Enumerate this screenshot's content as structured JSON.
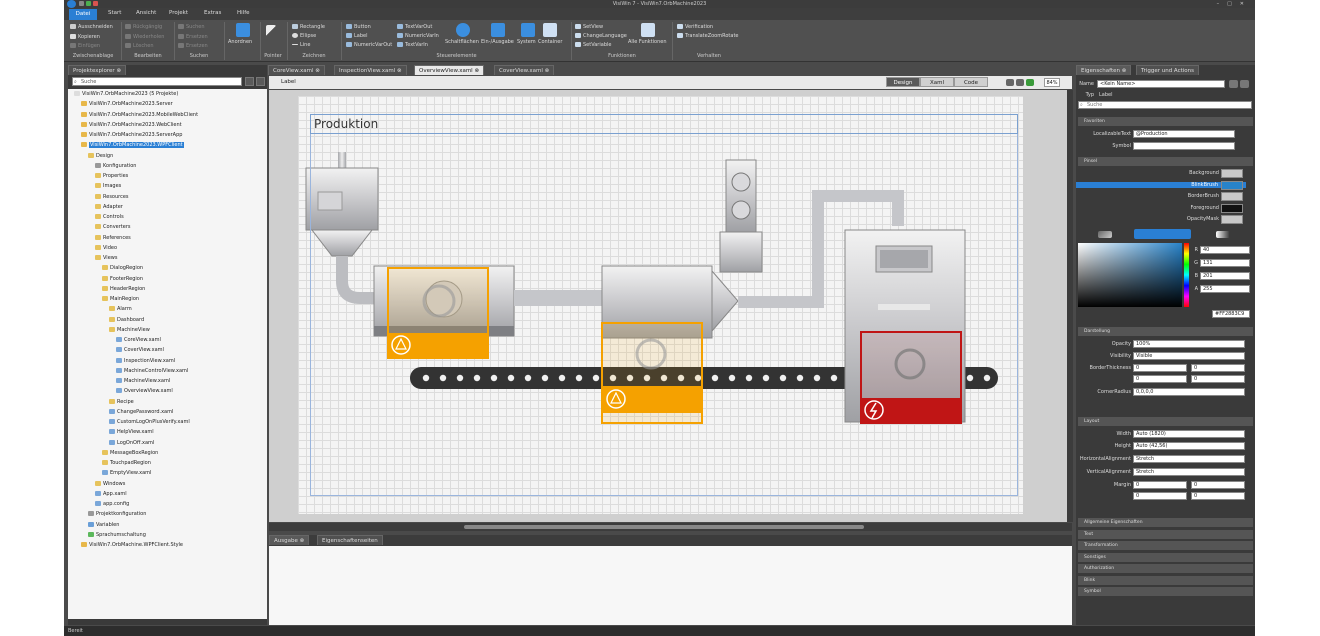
{
  "titlebar": {
    "title": "VisiWin 7 - VisiWin7.OrbMachine2023"
  },
  "menu": {
    "file": "Datei",
    "start": "Start",
    "view": "Ansicht",
    "project": "Projekt",
    "extras": "Extras",
    "help": "Hilfe"
  },
  "ribbon": {
    "clipboard": {
      "cut": "Ausschneiden",
      "copy": "Kopieren",
      "paste": "Einfügen",
      "label": "Zwischenablage"
    },
    "edit": {
      "undo": "Rückgängig",
      "redo": "Wiederholen",
      "delete": "Löschen",
      "label": "Bearbeiten"
    },
    "search": {
      "find": "Suchen",
      "replace": "Ersetzen",
      "replace_all": "Ersetzen",
      "label": "Suchen"
    },
    "arrange": {
      "label": "Anordnen"
    },
    "pointer": {
      "label": "Pointer"
    },
    "draw": {
      "rectangle": "Rectangle",
      "ellipse": "Ellipse",
      "line": "Line",
      "label": "Zeichnen"
    },
    "controls": {
      "button": "Button",
      "label_ctrl": "Label",
      "numericvarout": "NumericVarOut",
      "textvarout": "TextVarOut",
      "numericvarin": "NumericVarIn",
      "textvarin": "TextVarIn",
      "switches": "Schaltflächen",
      "io": "Ein-/Ausgabe",
      "system": "System",
      "container": "Container",
      "label": "Steuerelemente"
    },
    "functions": {
      "setview": "SetView",
      "changelanguage": "ChangeLanguage",
      "setvariable": "SetVariable",
      "all": "Alle Funktionen",
      "label": "Funktionen"
    },
    "behaviors": {
      "verification": "Verification",
      "translatezoomrotate": "TranslateZoomRotate",
      "label": "Verhalten"
    }
  },
  "left": {
    "tab": "Projektexplorer",
    "search_placeholder": "Suche",
    "tree": [
      {
        "label": "VisiWin7.OrbMachine2023 (5 Projekte)",
        "level": 0,
        "icon": "solution",
        "selected": false
      },
      {
        "label": "VisiWin7.OrbMachine2023.Server",
        "level": 1,
        "icon": "project",
        "selected": false
      },
      {
        "label": "VisiWin7.OrbMachine2023.MobileWebClient",
        "level": 1,
        "icon": "project",
        "selected": false
      },
      {
        "label": "VisiWin7.OrbMachine2023.WebClient",
        "level": 1,
        "icon": "project",
        "selected": false
      },
      {
        "label": "VisiWin7.OrbMachine2023.ServerApp",
        "level": 1,
        "icon": "project",
        "selected": false
      },
      {
        "label": "VisiWin7.OrbMachine2023.WPFClient",
        "level": 1,
        "icon": "project",
        "selected": true
      },
      {
        "label": "Design",
        "level": 2,
        "icon": "folder",
        "selected": false
      },
      {
        "label": "Konfiguration",
        "level": 3,
        "icon": "config",
        "selected": false
      },
      {
        "label": "Properties",
        "level": 3,
        "icon": "folder",
        "selected": false
      },
      {
        "label": "Images",
        "level": 3,
        "icon": "folder",
        "selected": false
      },
      {
        "label": "Resources",
        "level": 3,
        "icon": "folder",
        "selected": false
      },
      {
        "label": "Adapter",
        "level": 3,
        "icon": "folder",
        "selected": false
      },
      {
        "label": "Controls",
        "level": 3,
        "icon": "folder",
        "selected": false
      },
      {
        "label": "Converters",
        "level": 3,
        "icon": "folder",
        "selected": false
      },
      {
        "label": "References",
        "level": 3,
        "icon": "folder",
        "selected": false
      },
      {
        "label": "Video",
        "level": 3,
        "icon": "folder",
        "selected": false
      },
      {
        "label": "Views",
        "level": 3,
        "icon": "folder",
        "selected": false
      },
      {
        "label": "DialogRegion",
        "level": 4,
        "icon": "folder",
        "selected": false
      },
      {
        "label": "FooterRegion",
        "level": 4,
        "icon": "folder",
        "selected": false
      },
      {
        "label": "HeaderRegion",
        "level": 4,
        "icon": "folder",
        "selected": false
      },
      {
        "label": "MainRegion",
        "level": 4,
        "icon": "folder",
        "selected": false
      },
      {
        "label": "Alarm",
        "level": 5,
        "icon": "folder",
        "selected": false
      },
      {
        "label": "Dashboard",
        "level": 5,
        "icon": "folder",
        "selected": false
      },
      {
        "label": "MachineView",
        "level": 5,
        "icon": "folder",
        "selected": false
      },
      {
        "label": "CoreView.xaml",
        "level": 6,
        "icon": "file",
        "selected": false
      },
      {
        "label": "CoverView.xaml",
        "level": 6,
        "icon": "file",
        "selected": false
      },
      {
        "label": "InspectionView.xaml",
        "level": 6,
        "icon": "file",
        "selected": false
      },
      {
        "label": "MachineControlView.xaml",
        "level": 6,
        "icon": "file",
        "selected": false
      },
      {
        "label": "MachineView.xaml",
        "level": 6,
        "icon": "file",
        "selected": false
      },
      {
        "label": "OverviewView.xaml",
        "level": 6,
        "icon": "file",
        "selected": false
      },
      {
        "label": "Recipe",
        "level": 5,
        "icon": "folder",
        "selected": false
      },
      {
        "label": "ChangePassword.xaml",
        "level": 5,
        "icon": "file",
        "selected": false
      },
      {
        "label": "CustomLogOnPlusVerify.xaml",
        "level": 5,
        "icon": "file",
        "selected": false
      },
      {
        "label": "HelpView.xaml",
        "level": 5,
        "icon": "file",
        "selected": false
      },
      {
        "label": "LogOnOff.xaml",
        "level": 5,
        "icon": "file",
        "selected": false
      },
      {
        "label": "MessageBoxRegion",
        "level": 4,
        "icon": "folder",
        "selected": false
      },
      {
        "label": "TouchpadRegion",
        "level": 4,
        "icon": "folder",
        "selected": false
      },
      {
        "label": "EmptyView.xaml",
        "level": 4,
        "icon": "file",
        "selected": false
      },
      {
        "label": "Windows",
        "level": 3,
        "icon": "folder",
        "selected": false
      },
      {
        "label": "App.xaml",
        "level": 3,
        "icon": "file",
        "selected": false
      },
      {
        "label": "app.config",
        "level": 3,
        "icon": "file",
        "selected": false
      },
      {
        "label": "Projektkonfiguration",
        "level": 2,
        "icon": "config",
        "selected": false
      },
      {
        "label": "Variablen",
        "level": 2,
        "icon": "vars",
        "selected": false
      },
      {
        "label": "Sprachumschaltung",
        "level": 2,
        "icon": "lang",
        "selected": false
      },
      {
        "label": "VisiWin7.OrbMachine.WPFClient.Style",
        "level": 1,
        "icon": "project",
        "selected": false
      }
    ]
  },
  "doctabs": [
    "CoreView.xaml",
    "InspectionView.xaml",
    "OverviewView.xaml",
    "CoverView.xaml"
  ],
  "designer": {
    "selected_type": "Label",
    "mode_design": "Design",
    "mode_xaml": "Xaml",
    "mode_code": "Code",
    "zoom": "84%",
    "production_title": "Produktion"
  },
  "output": {
    "tab_output": "Ausgabe",
    "tab_props": "Eigenschaftenseiten"
  },
  "right": {
    "tab_props": "Eigenschaften",
    "tab_triggers": "Trigger und Actions",
    "name_label": "Name",
    "name_value": "<Kein Name>",
    "type_label": "Typ",
    "type_value": "Label",
    "search_placeholder": "Suche",
    "sect_favorites": "Favoriten",
    "localizable_label": "LocalizableText",
    "localizable_value": "@Production",
    "symbol_label": "Symbol",
    "sect_brush": "Pinsel",
    "brushes": [
      "Background",
      "BlinkBrush",
      "BorderBrush",
      "Foreground",
      "OpacityMask"
    ],
    "rgba": {
      "r_label": "R",
      "r": "40",
      "g_label": "G",
      "g": "131",
      "b_label": "B",
      "b": "201",
      "a_label": "A",
      "a": "255"
    },
    "hex": "#FF2883C9",
    "sect_appearance": "Darstellung",
    "opacity_label": "Opacity",
    "opacity_value": "100%",
    "visibility_label": "Visibility",
    "visibility_value": "Visible",
    "border_label": "BorderThickness",
    "corner_label": "CornerRadius",
    "corner_value": "0,0,0,0",
    "zero": "0",
    "sect_layout": "Layout",
    "width_label": "Width",
    "width_value": "Auto (1820)",
    "height_label": "Height",
    "height_value": "Auto (42,56)",
    "halign_label": "HorizontalAlignment",
    "halign_value": "Stretch",
    "valign_label": "VerticalAlignment",
    "valign_value": "Stretch",
    "margin_label": "Margin",
    "collapsed": [
      "Allgemeine Eigenschaften",
      "Text",
      "Transformation",
      "Sonstiges",
      "Authorization",
      "Blink",
      "Symbol"
    ]
  },
  "status": "Bereit",
  "colors": {
    "accent": "#2a7fd4",
    "warning": "#f5a100",
    "alarm": "#c01515",
    "conveyor": "#333333"
  }
}
